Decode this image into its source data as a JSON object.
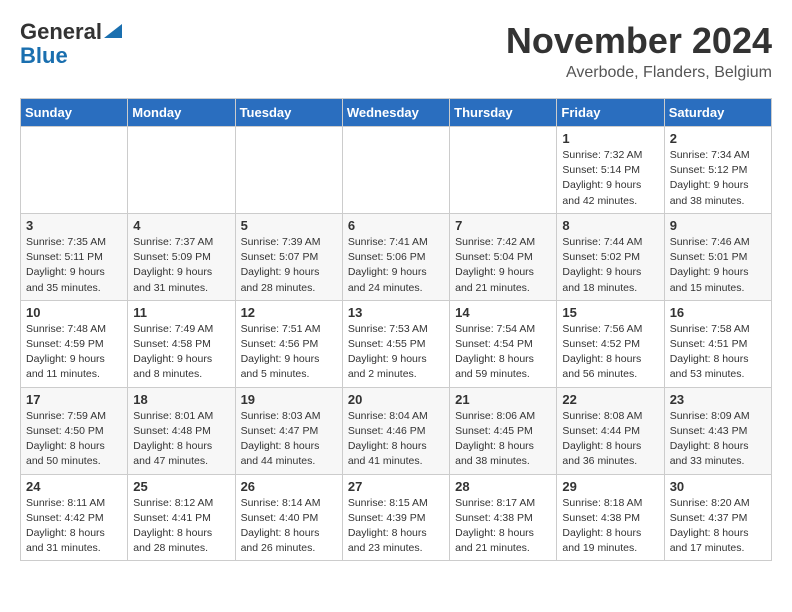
{
  "header": {
    "logo_line1": "General",
    "logo_line2": "Blue",
    "month": "November 2024",
    "location": "Averbode, Flanders, Belgium"
  },
  "calendar": {
    "headers": [
      "Sunday",
      "Monday",
      "Tuesday",
      "Wednesday",
      "Thursday",
      "Friday",
      "Saturday"
    ],
    "weeks": [
      [
        {
          "day": "",
          "info": ""
        },
        {
          "day": "",
          "info": ""
        },
        {
          "day": "",
          "info": ""
        },
        {
          "day": "",
          "info": ""
        },
        {
          "day": "",
          "info": ""
        },
        {
          "day": "1",
          "info": "Sunrise: 7:32 AM\nSunset: 5:14 PM\nDaylight: 9 hours and 42 minutes."
        },
        {
          "day": "2",
          "info": "Sunrise: 7:34 AM\nSunset: 5:12 PM\nDaylight: 9 hours and 38 minutes."
        }
      ],
      [
        {
          "day": "3",
          "info": "Sunrise: 7:35 AM\nSunset: 5:11 PM\nDaylight: 9 hours and 35 minutes."
        },
        {
          "day": "4",
          "info": "Sunrise: 7:37 AM\nSunset: 5:09 PM\nDaylight: 9 hours and 31 minutes."
        },
        {
          "day": "5",
          "info": "Sunrise: 7:39 AM\nSunset: 5:07 PM\nDaylight: 9 hours and 28 minutes."
        },
        {
          "day": "6",
          "info": "Sunrise: 7:41 AM\nSunset: 5:06 PM\nDaylight: 9 hours and 24 minutes."
        },
        {
          "day": "7",
          "info": "Sunrise: 7:42 AM\nSunset: 5:04 PM\nDaylight: 9 hours and 21 minutes."
        },
        {
          "day": "8",
          "info": "Sunrise: 7:44 AM\nSunset: 5:02 PM\nDaylight: 9 hours and 18 minutes."
        },
        {
          "day": "9",
          "info": "Sunrise: 7:46 AM\nSunset: 5:01 PM\nDaylight: 9 hours and 15 minutes."
        }
      ],
      [
        {
          "day": "10",
          "info": "Sunrise: 7:48 AM\nSunset: 4:59 PM\nDaylight: 9 hours and 11 minutes."
        },
        {
          "day": "11",
          "info": "Sunrise: 7:49 AM\nSunset: 4:58 PM\nDaylight: 9 hours and 8 minutes."
        },
        {
          "day": "12",
          "info": "Sunrise: 7:51 AM\nSunset: 4:56 PM\nDaylight: 9 hours and 5 minutes."
        },
        {
          "day": "13",
          "info": "Sunrise: 7:53 AM\nSunset: 4:55 PM\nDaylight: 9 hours and 2 minutes."
        },
        {
          "day": "14",
          "info": "Sunrise: 7:54 AM\nSunset: 4:54 PM\nDaylight: 8 hours and 59 minutes."
        },
        {
          "day": "15",
          "info": "Sunrise: 7:56 AM\nSunset: 4:52 PM\nDaylight: 8 hours and 56 minutes."
        },
        {
          "day": "16",
          "info": "Sunrise: 7:58 AM\nSunset: 4:51 PM\nDaylight: 8 hours and 53 minutes."
        }
      ],
      [
        {
          "day": "17",
          "info": "Sunrise: 7:59 AM\nSunset: 4:50 PM\nDaylight: 8 hours and 50 minutes."
        },
        {
          "day": "18",
          "info": "Sunrise: 8:01 AM\nSunset: 4:48 PM\nDaylight: 8 hours and 47 minutes."
        },
        {
          "day": "19",
          "info": "Sunrise: 8:03 AM\nSunset: 4:47 PM\nDaylight: 8 hours and 44 minutes."
        },
        {
          "day": "20",
          "info": "Sunrise: 8:04 AM\nSunset: 4:46 PM\nDaylight: 8 hours and 41 minutes."
        },
        {
          "day": "21",
          "info": "Sunrise: 8:06 AM\nSunset: 4:45 PM\nDaylight: 8 hours and 38 minutes."
        },
        {
          "day": "22",
          "info": "Sunrise: 8:08 AM\nSunset: 4:44 PM\nDaylight: 8 hours and 36 minutes."
        },
        {
          "day": "23",
          "info": "Sunrise: 8:09 AM\nSunset: 4:43 PM\nDaylight: 8 hours and 33 minutes."
        }
      ],
      [
        {
          "day": "24",
          "info": "Sunrise: 8:11 AM\nSunset: 4:42 PM\nDaylight: 8 hours and 31 minutes."
        },
        {
          "day": "25",
          "info": "Sunrise: 8:12 AM\nSunset: 4:41 PM\nDaylight: 8 hours and 28 minutes."
        },
        {
          "day": "26",
          "info": "Sunrise: 8:14 AM\nSunset: 4:40 PM\nDaylight: 8 hours and 26 minutes."
        },
        {
          "day": "27",
          "info": "Sunrise: 8:15 AM\nSunset: 4:39 PM\nDaylight: 8 hours and 23 minutes."
        },
        {
          "day": "28",
          "info": "Sunrise: 8:17 AM\nSunset: 4:38 PM\nDaylight: 8 hours and 21 minutes."
        },
        {
          "day": "29",
          "info": "Sunrise: 8:18 AM\nSunset: 4:38 PM\nDaylight: 8 hours and 19 minutes."
        },
        {
          "day": "30",
          "info": "Sunrise: 8:20 AM\nSunset: 4:37 PM\nDaylight: 8 hours and 17 minutes."
        }
      ]
    ]
  }
}
